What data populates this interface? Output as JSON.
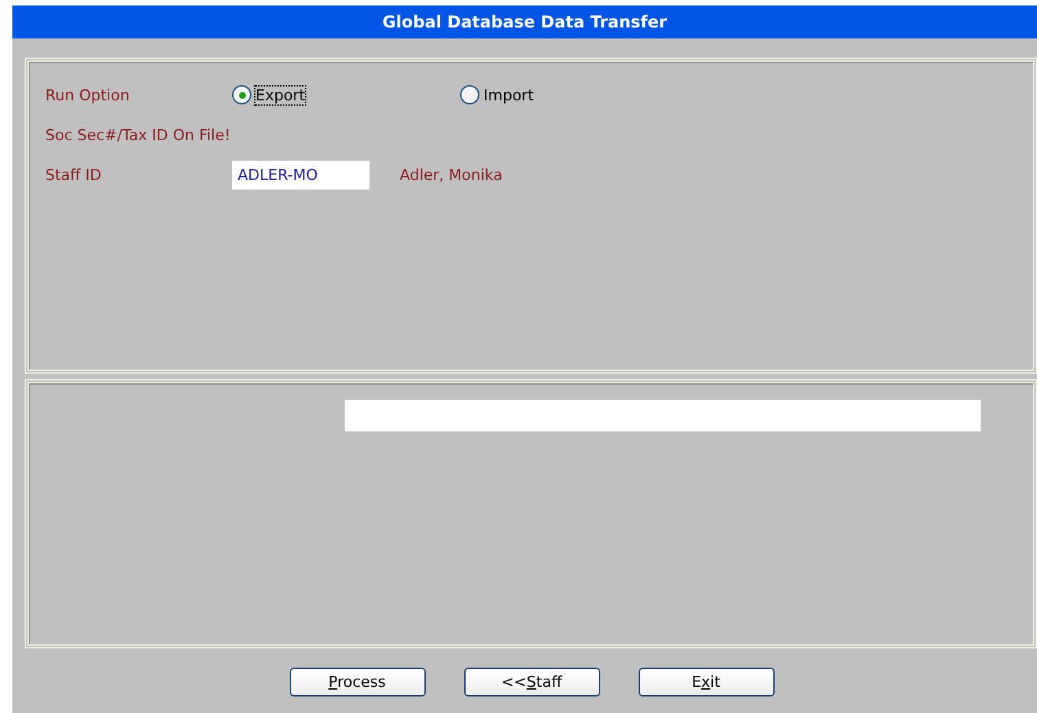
{
  "window": {
    "title": "Global Database Data Transfer"
  },
  "run_option": {
    "label": "Run Option",
    "options": [
      {
        "label": "Export",
        "selected": true
      },
      {
        "label": "Import",
        "selected": false
      }
    ]
  },
  "notice": "Soc Sec#/Tax ID On File!",
  "staff": {
    "label": "Staff ID",
    "value": "ADLER-MO",
    "name": "Adler, Monika"
  },
  "buttons": [
    {
      "key": "P",
      "suffix": "rocess"
    },
    {
      "prefix": "<<",
      "key": "S",
      "suffix": "taff"
    },
    {
      "prefix": "E",
      "key": "x",
      "suffix": "it"
    }
  ]
}
